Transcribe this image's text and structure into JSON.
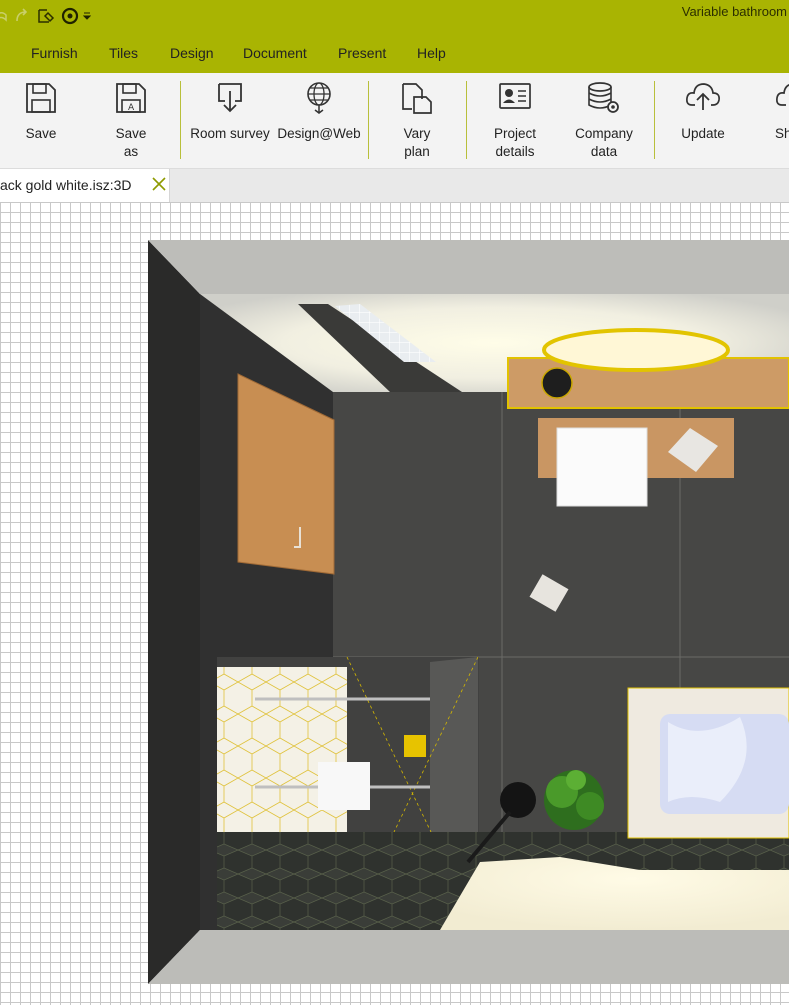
{
  "app": {
    "title": "Variable bathroom"
  },
  "quick_access": [
    {
      "name": "undo-icon"
    },
    {
      "name": "redo-icon"
    },
    {
      "name": "new-icon"
    },
    {
      "name": "target-icon"
    },
    {
      "name": "customize-dropdown-icon"
    }
  ],
  "menu": {
    "items": [
      "Furnish",
      "Tiles",
      "Design",
      "Document",
      "Present",
      "Help"
    ]
  },
  "ribbon": {
    "buttons": [
      {
        "label": "Save",
        "icon": "save-icon"
      },
      {
        "label": "Save\nas",
        "icon": "save-as-icon"
      },
      {
        "label": "Room survey",
        "icon": "room-survey-icon"
      },
      {
        "label": "Design@Web",
        "icon": "design-web-icon"
      },
      {
        "label": "Vary\nplan",
        "icon": "vary-plan-icon"
      },
      {
        "label": "Project\ndetails",
        "icon": "project-details-icon"
      },
      {
        "label": "Company\ndata",
        "icon": "company-data-icon"
      },
      {
        "label": "Update",
        "icon": "cloud-upload-icon"
      },
      {
        "label": "Sh",
        "icon": "share-icon"
      }
    ]
  },
  "tabs": {
    "active_label": "ack gold white.isz:3D",
    "close_icon": "close-icon"
  },
  "colors": {
    "accent": "#a9b402",
    "ribbon_bg": "#f3f3f3",
    "grid": "#c8c8c8",
    "gold": "#e8c400",
    "floor": "#444444",
    "wood": "#c9915a"
  }
}
